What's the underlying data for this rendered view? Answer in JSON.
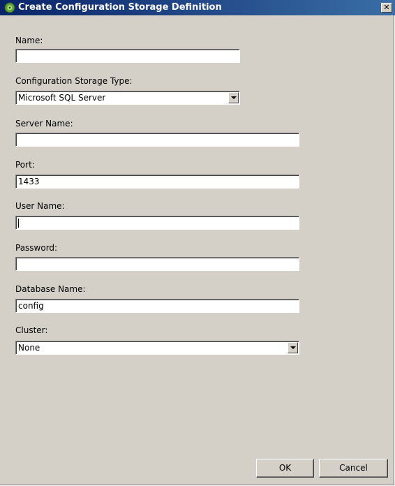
{
  "dialog": {
    "title": "Create Configuration Storage Definition",
    "close_label": "✕"
  },
  "form": {
    "name": {
      "label": "Name:",
      "value": ""
    },
    "storage_type": {
      "label": "Configuration Storage Type:",
      "value": "Microsoft SQL Server"
    },
    "server_name": {
      "label": "Server Name:",
      "value": ""
    },
    "port": {
      "label": "Port:",
      "value": "1433"
    },
    "user_name": {
      "label": "User Name:",
      "value": ""
    },
    "password": {
      "label": "Password:",
      "value": ""
    },
    "database_name": {
      "label": "Database Name:",
      "value": "config"
    },
    "cluster": {
      "label": "Cluster:",
      "value": "None"
    }
  },
  "buttons": {
    "ok": "OK",
    "cancel": "Cancel"
  },
  "icons": {
    "title": "app-icon",
    "dropdown": "chevron-down-icon"
  }
}
